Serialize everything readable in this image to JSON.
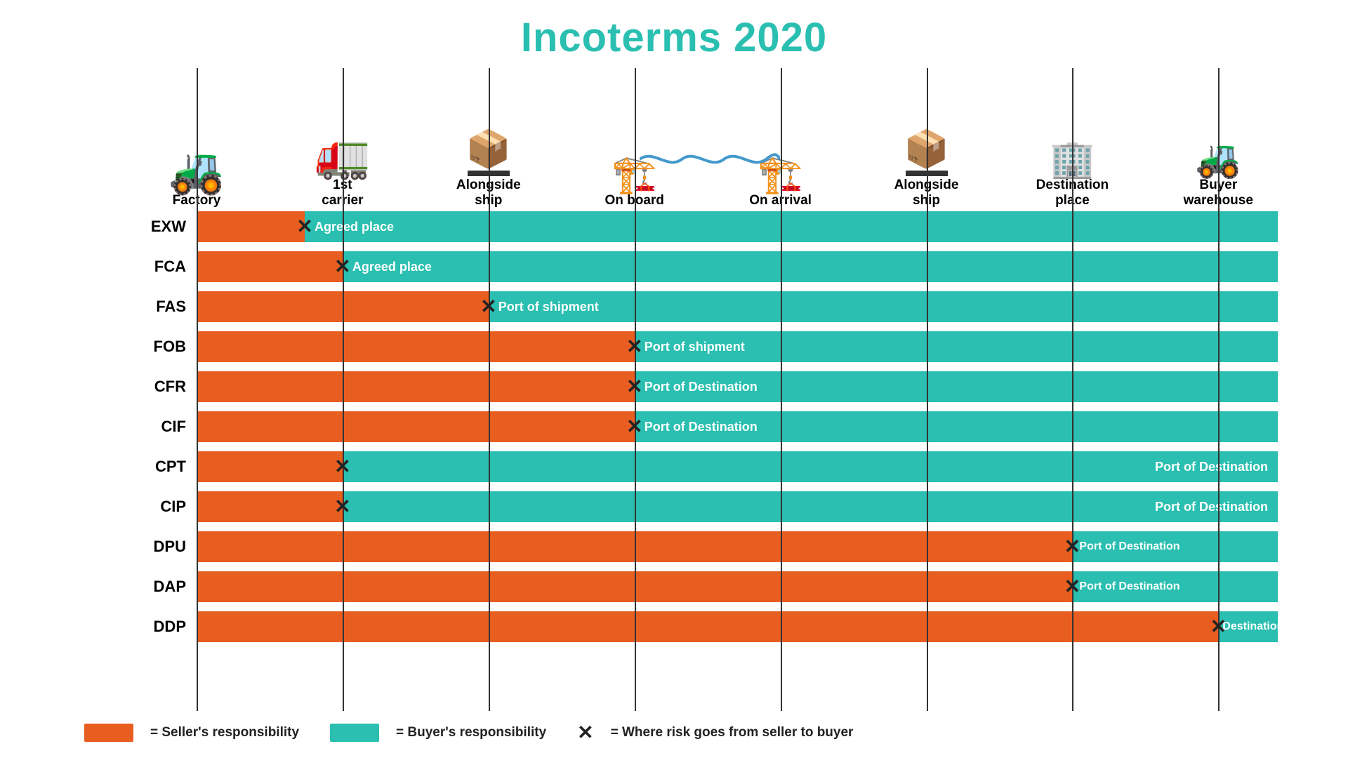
{
  "title": "Incoterms 2020",
  "columns": [
    {
      "id": "factory",
      "label": "Factory",
      "icon": "🚜",
      "left_pct": 0
    },
    {
      "id": "carrier1",
      "label": "1st\ncarrier",
      "icon": "🚛",
      "left_pct": 13.5
    },
    {
      "id": "alongside1",
      "label": "Alongside\nship",
      "icon": "📦",
      "left_pct": 27
    },
    {
      "id": "onboard",
      "label": "On board",
      "icon": "🏗️",
      "left_pct": 40.5
    },
    {
      "id": "onarrival",
      "label": "On arrival",
      "icon": "🏗️",
      "left_pct": 54
    },
    {
      "id": "alongside2",
      "label": "Alongside\nship",
      "icon": "📦",
      "left_pct": 67.5
    },
    {
      "id": "destplace",
      "label": "Destination\nplace",
      "icon": "🏢",
      "left_pct": 81
    },
    {
      "id": "buyerwh",
      "label": "Buyer\nwarehouse",
      "icon": "🚜",
      "left_pct": 94.5
    }
  ],
  "rows": [
    {
      "term": "EXW",
      "cross_pct": 10,
      "orange_pct": 10,
      "teal_label": "Agreed place"
    },
    {
      "term": "FCA",
      "cross_pct": 13.5,
      "orange_pct": 13.5,
      "teal_label": "Agreed place"
    },
    {
      "term": "FAS",
      "cross_pct": 27,
      "orange_pct": 27,
      "teal_label": "Port of shipment"
    },
    {
      "term": "FOB",
      "cross_pct": 40.5,
      "orange_pct": 40.5,
      "teal_label": "Port of shipment"
    },
    {
      "term": "CFR",
      "cross_pct": 40.5,
      "orange_pct": 40.5,
      "teal_label": "Port of Destination"
    },
    {
      "term": "CIF",
      "cross_pct": 40.5,
      "orange_pct": 40.5,
      "teal_label": "Port of Destination"
    },
    {
      "term": "CPT",
      "cross_pct": 13.5,
      "orange_pct": 13.5,
      "teal_label": "Port of Destination"
    },
    {
      "term": "CIP",
      "cross_pct": 13.5,
      "orange_pct": 13.5,
      "teal_label": "Port of Destination"
    },
    {
      "term": "DPU",
      "cross_pct": 81,
      "orange_pct": 81,
      "teal_label": "Port of Destination"
    },
    {
      "term": "DAP",
      "cross_pct": 81,
      "orange_pct": 81,
      "teal_label": "Port of Destination"
    },
    {
      "term": "DDP",
      "cross_pct": 94.5,
      "orange_pct": 94.5,
      "teal_label": "Destination"
    }
  ],
  "legend": {
    "seller_label": "= Seller's responsibility",
    "buyer_label": "= Buyer's responsibility",
    "cross_label": "= Where risk goes from seller to buyer"
  },
  "colors": {
    "orange": "#e85d20",
    "teal": "#2abfb0",
    "title": "#2abfb0"
  }
}
